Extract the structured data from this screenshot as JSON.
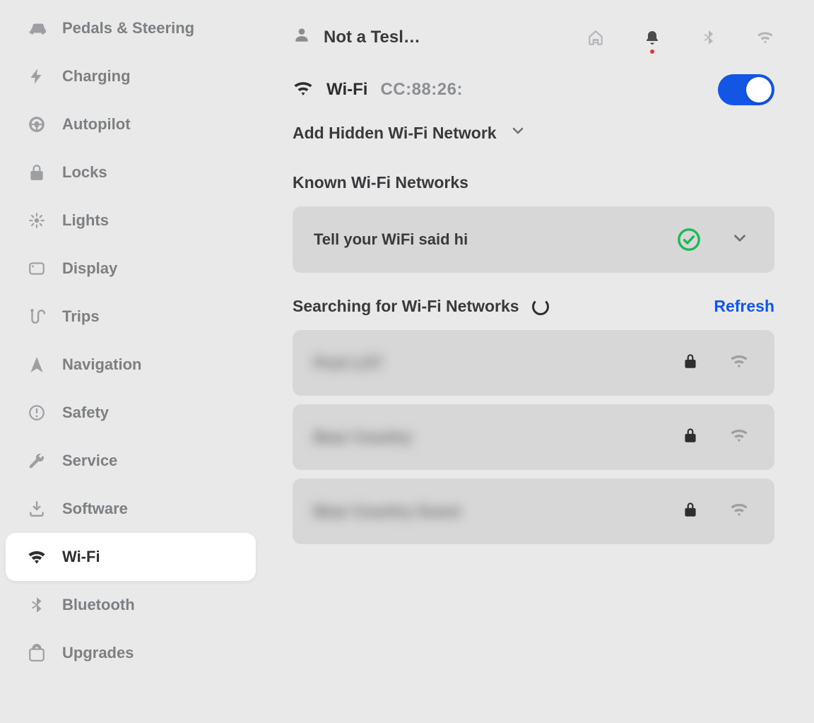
{
  "sidebar": {
    "items": [
      {
        "label": "Pedals & Steering",
        "icon": "car",
        "active": false
      },
      {
        "label": "Charging",
        "icon": "bolt",
        "active": false
      },
      {
        "label": "Autopilot",
        "icon": "steering",
        "active": false
      },
      {
        "label": "Locks",
        "icon": "lock",
        "active": false
      },
      {
        "label": "Lights",
        "icon": "light",
        "active": false
      },
      {
        "label": "Display",
        "icon": "display",
        "active": false
      },
      {
        "label": "Trips",
        "icon": "trips",
        "active": false
      },
      {
        "label": "Navigation",
        "icon": "nav",
        "active": false
      },
      {
        "label": "Safety",
        "icon": "warn",
        "active": false
      },
      {
        "label": "Service",
        "icon": "wrench",
        "active": false
      },
      {
        "label": "Software",
        "icon": "download",
        "active": false
      },
      {
        "label": "Wi-Fi",
        "icon": "wifi",
        "active": true
      },
      {
        "label": "Bluetooth",
        "icon": "bluetooth",
        "active": false
      },
      {
        "label": "Upgrades",
        "icon": "bag",
        "active": false
      }
    ]
  },
  "header": {
    "profile_name": "Not a Tesl…",
    "status_icons": [
      "homelink",
      "bell",
      "bluetooth",
      "wifi"
    ],
    "bell_notification": true
  },
  "wifi": {
    "title": "Wi-Fi",
    "mac": "CC:88:26:",
    "enabled": true,
    "add_hidden_label": "Add Hidden Wi-Fi Network",
    "known_heading": "Known Wi-Fi Networks",
    "known": [
      {
        "ssid": "Tell your WiFi said hi",
        "connected": true
      }
    ],
    "search_label": "Searching for Wi-Fi Networks",
    "searching": true,
    "refresh_label": "Refresh",
    "found": [
      {
        "ssid": "Pool LOT",
        "locked": true,
        "signal": 3,
        "blurred": true
      },
      {
        "ssid": "Bear Country",
        "locked": true,
        "signal": 2,
        "blurred": true
      },
      {
        "ssid": "Bear Country Guest",
        "locked": true,
        "signal": 2,
        "blurred": true
      }
    ]
  }
}
